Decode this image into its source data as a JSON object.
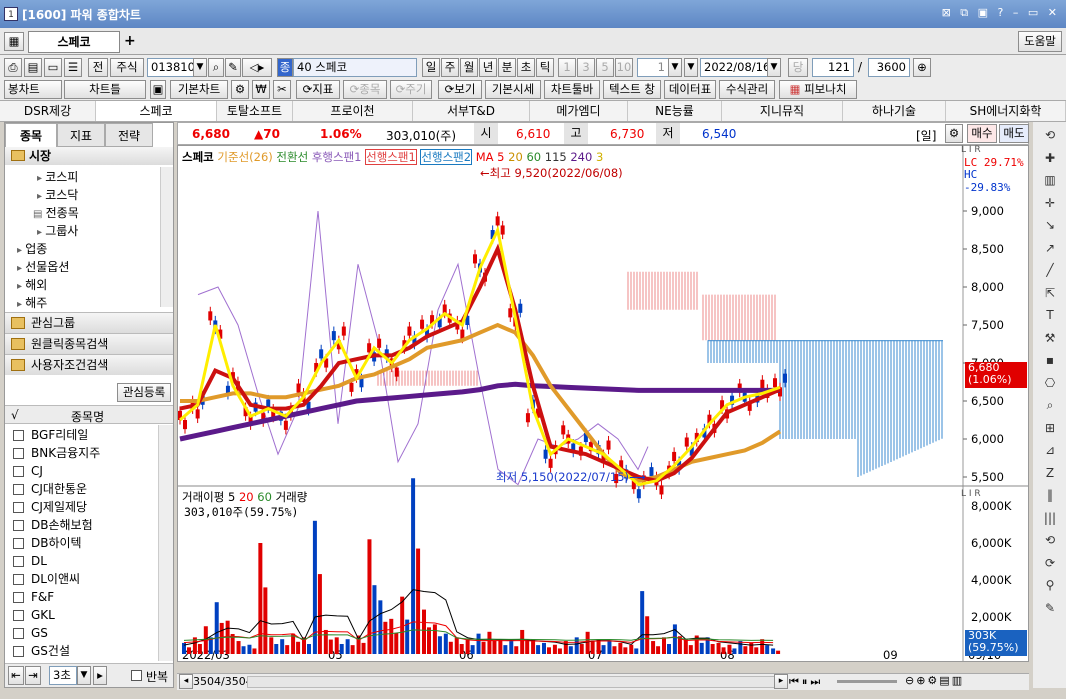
{
  "window": {
    "title": "[1600] 파워 종합차트",
    "icon": "1",
    "buttons": "⊠ ⧉ ▣ ? – ▭ ✕"
  },
  "tabs": {
    "active": "스페코",
    "add": "+",
    "help": "도움말"
  },
  "toolbar1": {
    "stock_type": "주식",
    "code": "013810",
    "group_num": "40",
    "stock_name": "스페코",
    "periods": [
      "일",
      "주",
      "월",
      "년",
      "분",
      "초",
      "틱"
    ],
    "intervals": [
      "1",
      "3",
      "5",
      "10"
    ],
    "interval_value": "1",
    "date": "2022/08/16",
    "count": "121",
    "max": "3600",
    "slash": "/",
    "btn_jeon": "전"
  },
  "toolbar2": {
    "items": [
      "봉차트",
      "차트틀",
      "기본차트",
      "₩",
      "지표",
      "종목",
      "주기",
      "보기",
      "기본시세",
      "차트툴바",
      "텍스트 창",
      "데이터표",
      "수식관리",
      "피보나치"
    ]
  },
  "compare": [
    "DSR제강",
    "스페코",
    "토탈소프트",
    "프로이천",
    "서부T&D",
    "메가엠디",
    "NE능률",
    "지니뮤직",
    "하나기술",
    "SH에너지화학"
  ],
  "left": {
    "tabs": [
      "종목",
      "지표",
      "전략"
    ],
    "tree_root": "시장",
    "tree": [
      "코스피",
      "코스닥",
      "전종목",
      "그룹사",
      "업종",
      "선물옵션",
      "해외",
      "해주"
    ],
    "sections": [
      "관심그룹",
      "원클릭종목검색",
      "사용자조건검색"
    ],
    "register_btn": "관심등록",
    "list_header": "종목명",
    "check_mark": "√",
    "stocks": [
      "BGF리테일",
      "BNK금융지주",
      "CJ",
      "CJ대한통운",
      "CJ제일제당",
      "DB손해보험",
      "DB하이텍",
      "DL",
      "DL이앤씨",
      "F&F",
      "GKL",
      "GS",
      "GS건설"
    ],
    "footer_select": "3초",
    "footer_repeat": "반복"
  },
  "price": {
    "current": "6,680",
    "change": "▲70",
    "rate": "1.06%",
    "volume": "303,010(주)",
    "open_lbl": "시",
    "open": "6,610",
    "high_lbl": "고",
    "high": "6,730",
    "low_lbl": "저",
    "low": "6,540",
    "period_lbl": "[일]",
    "buy": "매수",
    "sell": "매도"
  },
  "chart": {
    "legend_stock": "스페코",
    "legend": [
      "기준선(26)",
      "전환선",
      "후행스팬1",
      "선행스팬1",
      "선행스팬2"
    ],
    "ma_label": "MA",
    "ma_periods": [
      "5",
      "20",
      "60",
      "115",
      "240",
      "3"
    ],
    "lc": "LC  29.71%",
    "hc": "HC -29.83%",
    "max_label": "←최고 9,520(2022/06/08)",
    "min_label": "최저 5,150(2022/07/15)⟶",
    "price_tag": "6,680",
    "price_tag_pct": "(1.06%)",
    "lir": "L I R",
    "vol_legend_a": "거래이평",
    "vol_ma": [
      "5",
      "20",
      "60"
    ],
    "vol_legend_b": "거래량",
    "vol_value": "303,010주(59.75%)",
    "vol_tag": "303K",
    "vol_tag_pct": "(59.75%)",
    "dates": [
      "2022/03",
      "05",
      "06",
      "07",
      "08",
      "09",
      "09/10"
    ],
    "nav_text": "3504/3504"
  },
  "chart_data": [
    {
      "type": "line",
      "title": "스페코",
      "y_ticks": [
        5500,
        6000,
        6500,
        7000,
        7500,
        8000,
        8500,
        9000
      ],
      "ylim": [
        5150,
        9520
      ],
      "x_labels": [
        "2022/03",
        "05",
        "06",
        "07",
        "08",
        "09",
        "09/10"
      ],
      "annotations": [
        "최고 9,520(2022/06/08)",
        "최저 5,150(2022/07/15)"
      ],
      "last": 6680,
      "series": [
        {
          "name": "5",
          "values": [
            6250,
            6450,
            7500,
            6700,
            6300,
            6400,
            6300,
            6550,
            7000,
            7300,
            6800,
            7200,
            7000,
            7300,
            7450,
            7650,
            7500,
            8250,
            8750,
            7600,
            6400,
            5800,
            6000,
            5900,
            5800,
            5600,
            5400,
            5450,
            5650,
            5900,
            6200,
            6450,
            6550,
            6600,
            6680
          ]
        },
        {
          "name": "20",
          "values": [
            6400,
            6450,
            6900,
            6800,
            6450,
            6400,
            6400,
            6450,
            6700,
            7000,
            7050,
            7100,
            7100,
            7200,
            7350,
            7450,
            7550,
            8000,
            8500,
            7700,
            6700,
            5900,
            5850,
            5800,
            5700,
            5600,
            5500,
            5450,
            5550,
            5750,
            6050,
            6350,
            6450,
            6550,
            6650
          ]
        },
        {
          "name": "60",
          "values": [
            6500,
            6500,
            6550,
            6600,
            6600,
            6550,
            6550,
            6600,
            6650,
            6700,
            6800,
            6850,
            6950,
            7050,
            7200,
            7250,
            7300,
            7400,
            7500,
            7400,
            7100,
            6700,
            6400,
            6100,
            5800,
            5550,
            5450,
            5500,
            5600,
            5700,
            5750,
            5800,
            5850,
            5950,
            6100
          ]
        },
        {
          "name": "115",
          "values": [
            6000,
            6050,
            6100,
            6150,
            6200,
            6250,
            6300,
            6350,
            6400,
            6450,
            6500,
            6520,
            6540,
            6560,
            6580,
            6600,
            6620,
            6650,
            6700,
            6720,
            6700,
            6690,
            6680,
            6670,
            6660,
            6650,
            6640,
            6640,
            6640,
            6640,
            6640,
            6640,
            6640,
            6640,
            6640
          ]
        }
      ]
    },
    {
      "type": "bar",
      "title": "거래량",
      "y_ticks": [
        "2,000K",
        "4,000K",
        "6,000K",
        "8,000K"
      ],
      "values_k": [
        600,
        900,
        1500,
        2800,
        1800,
        700,
        500,
        6000,
        900,
        800,
        1100,
        900,
        7200,
        1300,
        900,
        800,
        1000,
        6200,
        2900,
        1900,
        3100,
        9500,
        2400,
        1600,
        1100,
        900,
        800,
        1100,
        1200,
        800,
        700,
        1300,
        800,
        600,
        500,
        700,
        900,
        1200,
        800,
        700,
        600,
        500,
        3400,
        700,
        900,
        1600,
        800,
        1000,
        900,
        600,
        500,
        700,
        600,
        800,
        300
      ]
    }
  ],
  "colors": {
    "up": "#e00000",
    "down": "#0040c0",
    "ma5": "#ffee00",
    "ma20": "#cc1010",
    "ma60": "#e09a2a",
    "ma115": "#5b1a8a",
    "title_bg": "#5d86c4"
  }
}
